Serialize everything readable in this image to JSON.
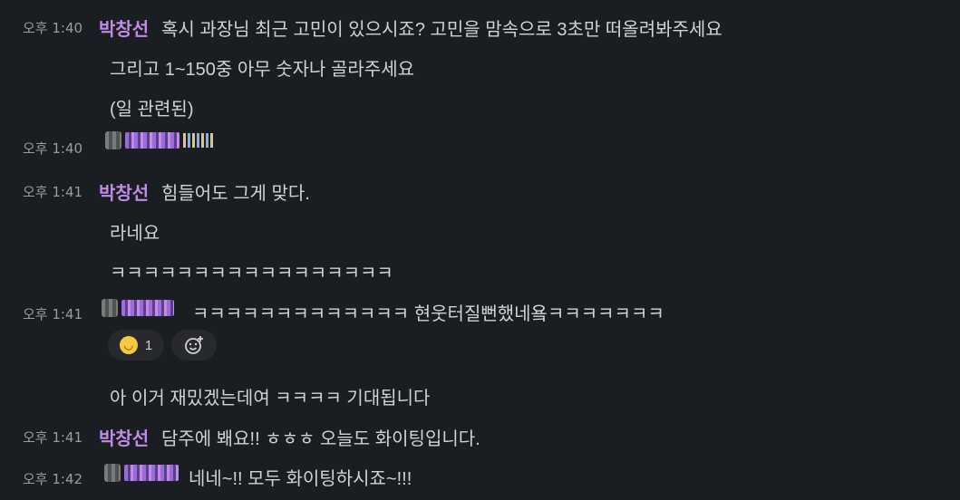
{
  "messages": [
    {
      "time": "오후 1:40",
      "name": "박창선",
      "text": "혹시 과장님 최근 고민이 있으시죠? 고민을 맘속으로 3초만 떠올려봐주세요"
    },
    {
      "text": "그리고 1~150중 아무 숫자나 골라주세요"
    },
    {
      "text": "(일 관련된)"
    },
    {
      "time": "오후 1:40"
    },
    {
      "time": "오후 1:41",
      "name": "박창선",
      "text": "힘들어도 그게 맞다."
    },
    {
      "text": "라네요"
    },
    {
      "text": "ㅋㅋㅋㅋㅋㅋㅋㅋㅋㅋㅋㅋㅋㅋㅋㅋㅋ"
    },
    {
      "time": "오후 1:41",
      "text": "ㅋㅋㅋㅋㅋㅋㅋㅋㅋㅋㅋㅋㅋ 현웃터질뻔했네욬ㅋㅋㅋㅋㅋㅋㅋ"
    },
    {
      "text": "아 이거 재밌겠는데여 ㅋㅋㅋㅋ 기대됩니다"
    },
    {
      "time": "오후 1:41",
      "name": "박창선",
      "text": "담주에 봬요!! ㅎㅎㅎ 오늘도 화이팅입니다."
    },
    {
      "time": "오후 1:42",
      "text": "네네~!! 모두 화이팅하시죠~!!!"
    }
  ],
  "reaction": {
    "count": "1"
  }
}
